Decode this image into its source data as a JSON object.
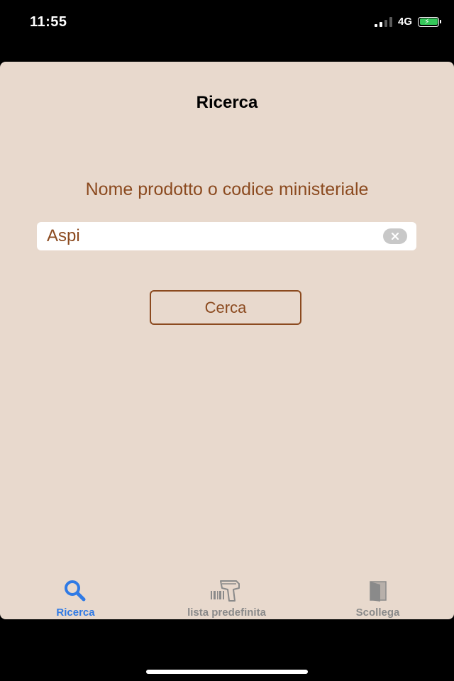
{
  "status_bar": {
    "time": "11:55",
    "network": "4G"
  },
  "header": {
    "title": "Ricerca"
  },
  "search": {
    "label": "Nome prodotto o codice ministeriale",
    "value": "Aspi",
    "button_label": "Cerca"
  },
  "tab_bar": {
    "tabs": [
      {
        "label": "Ricerca",
        "icon": "search-icon",
        "active": true
      },
      {
        "label": "lista predefinita",
        "icon": "barcode-scanner-icon",
        "active": false
      },
      {
        "label": "Scollega",
        "icon": "door-icon",
        "active": false
      }
    ]
  },
  "colors": {
    "background": "#e8d9cd",
    "accent_brown": "#8b4a1f",
    "active_tab": "#2f7ae5",
    "inactive_tab": "#8a8a8a"
  }
}
